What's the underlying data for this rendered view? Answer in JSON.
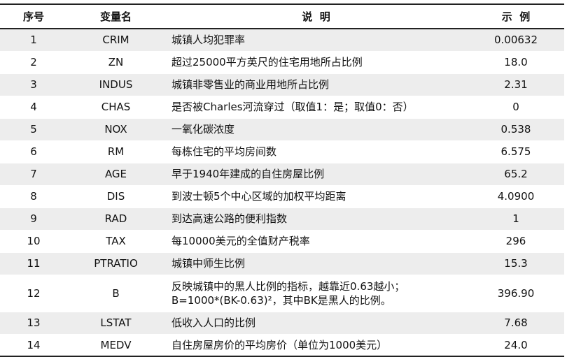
{
  "header": {
    "index": "序号",
    "variable": "变量名",
    "description": "说  明",
    "example": "示  例"
  },
  "rows": [
    {
      "index": "1",
      "variable": "CRIM",
      "description": "城镇人均犯罪率",
      "description2": "",
      "example": "0.00632"
    },
    {
      "index": "2",
      "variable": "ZN",
      "description": "超过25000平方英尺的住宅用地所占比例",
      "description2": "",
      "example": "18.0"
    },
    {
      "index": "3",
      "variable": "INDUS",
      "description": "城镇非零售业的商业用地所占比例",
      "description2": "",
      "example": "2.31"
    },
    {
      "index": "4",
      "variable": "CHAS",
      "description": "是否被Charles河流穿过（取值1：是；取值0：否）",
      "description2": "",
      "example": "0"
    },
    {
      "index": "5",
      "variable": "NOX",
      "description": "一氧化碳浓度",
      "description2": "",
      "example": "0.538"
    },
    {
      "index": "6",
      "variable": "RM",
      "description": "每栋住宅的平均房间数",
      "description2": "",
      "example": "6.575"
    },
    {
      "index": "7",
      "variable": "AGE",
      "description": "早于1940年建成的自住房屋比例",
      "description2": "",
      "example": "65.2"
    },
    {
      "index": "8",
      "variable": "DIS",
      "description": "到波士顿5个中心区域的加权平均距离",
      "description2": "",
      "example": "4.0900"
    },
    {
      "index": "9",
      "variable": "RAD",
      "description": "到达高速公路的便利指数",
      "description2": "",
      "example": "1"
    },
    {
      "index": "10",
      "variable": "TAX",
      "description": "每10000美元的全值财产税率",
      "description2": "",
      "example": "296"
    },
    {
      "index": "11",
      "variable": "PTRATIO",
      "description": "城镇中师生比例",
      "description2": "",
      "example": "15.3"
    },
    {
      "index": "12",
      "variable": "B",
      "description": "反映城镇中的黑人比例的指标，越靠近0.63越小；",
      "description2": "B=1000*(BK-0.63)²，其中BK是黑人的比例。",
      "example": "396.90"
    },
    {
      "index": "13",
      "variable": "LSTAT",
      "description": "低收入人口的比例",
      "description2": "",
      "example": "7.68"
    },
    {
      "index": "14",
      "variable": "MEDV",
      "description": "自住房屋房价的平均房价（单位为1000美元）",
      "description2": "",
      "example": "24.0"
    }
  ]
}
